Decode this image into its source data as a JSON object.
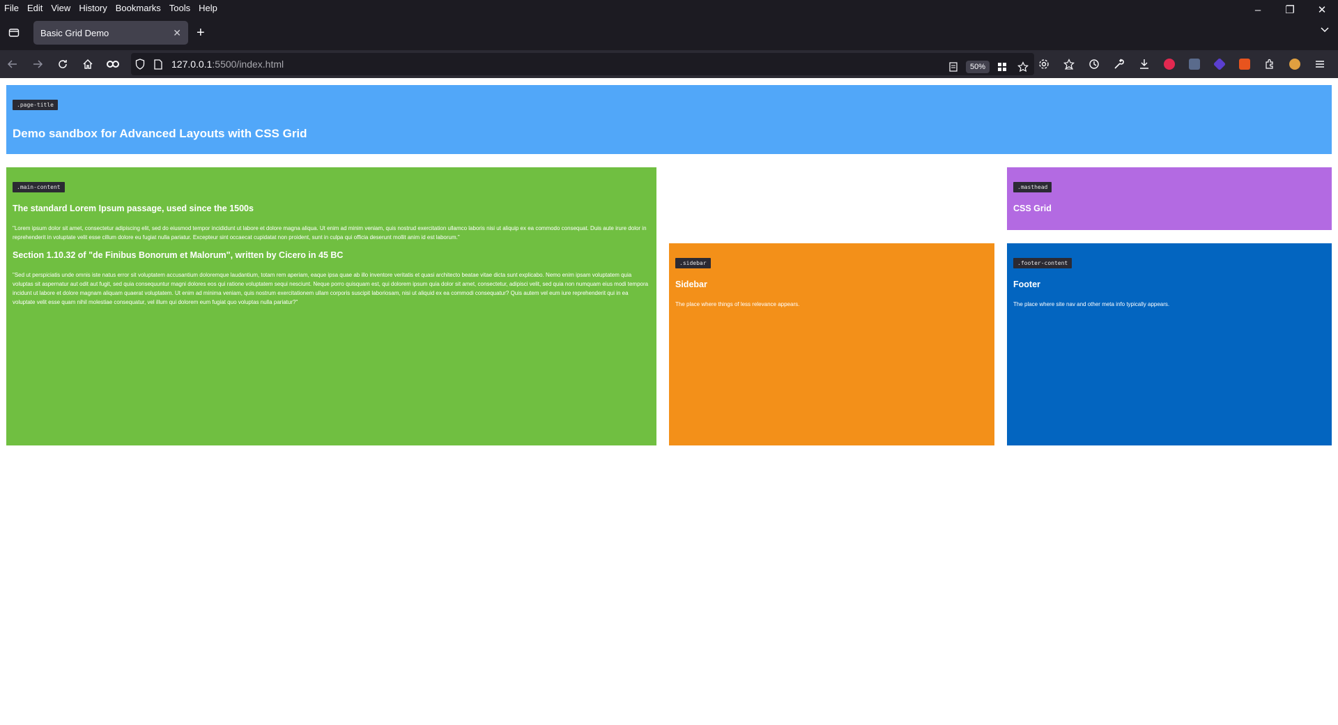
{
  "browser": {
    "menu": [
      "File",
      "Edit",
      "View",
      "History",
      "Bookmarks",
      "Tools",
      "Help"
    ],
    "tab": {
      "title": "Basic Grid Demo"
    },
    "url": {
      "host": "127.0.0.1",
      "rest": ":5500/index.html"
    },
    "zoom": "50%",
    "icons": {
      "back": "back-arrow-icon",
      "forward": "forward-arrow-icon",
      "reload": "reload-icon",
      "home": "home-icon",
      "private": "mask-icon",
      "shield": "shield-icon",
      "page": "page-icon"
    }
  },
  "page": {
    "title_box": {
      "tag": ".page-title",
      "heading": "Demo sandbox for Advanced Layouts with CSS Grid"
    },
    "main_box": {
      "tag": ".main-content",
      "heading1": "The standard Lorem Ipsum passage, used since the 1500s",
      "para1": "\"Lorem ipsum dolor sit amet, consectetur adipiscing elit, sed do eiusmod tempor incididunt ut labore et dolore magna aliqua. Ut enim ad minim veniam, quis nostrud exercitation ullamco laboris nisi ut aliquip ex ea commodo consequat. Duis aute irure dolor in reprehenderit in voluptate velit esse cillum dolore eu fugiat nulla pariatur. Excepteur sint occaecat cupidatat non proident, sunt in culpa qui officia deserunt mollit anim id est laborum.\"",
      "heading2": "Section 1.10.32 of \"de Finibus Bonorum et Malorum\", written by Cicero in 45 BC",
      "para2": "\"Sed ut perspiciatis unde omnis iste natus error sit voluptatem accusantium doloremque laudantium, totam rem aperiam, eaque ipsa quae ab illo inventore veritatis et quasi architecto beatae vitae dicta sunt explicabo. Nemo enim ipsam voluptatem quia voluptas sit aspernatur aut odit aut fugit, sed quia consequuntur magni dolores eos qui ratione voluptatem sequi nesciunt. Neque porro quisquam est, qui dolorem ipsum quia dolor sit amet, consectetur, adipisci velit, sed quia non numquam eius modi tempora incidunt ut labore et dolore magnam aliquam quaerat voluptatem. Ut enim ad minima veniam, quis nostrum exercitationem ullam corporis suscipit laboriosam, nisi ut aliquid ex ea commodi consequatur? Quis autem vel eum iure reprehenderit qui in ea voluptate velit esse quam nihil molestiae consequatur, vel illum qui dolorem eum fugiat quo voluptas nulla pariatur?\""
    },
    "masthead_box": {
      "tag": ".masthead",
      "heading": "CSS Grid"
    },
    "sidebar_box": {
      "tag": ".sidebar",
      "heading": "Sidebar",
      "text": "The place where things of less relevance appears."
    },
    "footer_box": {
      "tag": ".footer-content",
      "heading": "Footer",
      "text": "The place where site nav and other meta info typically appears."
    }
  },
  "colors": {
    "page_title": "#51a7f9",
    "main_content": "#70bf41",
    "masthead": "#b36ae2",
    "sidebar": "#f39019",
    "footer": "#0365c0",
    "chrome_bg": "#1c1b22"
  }
}
